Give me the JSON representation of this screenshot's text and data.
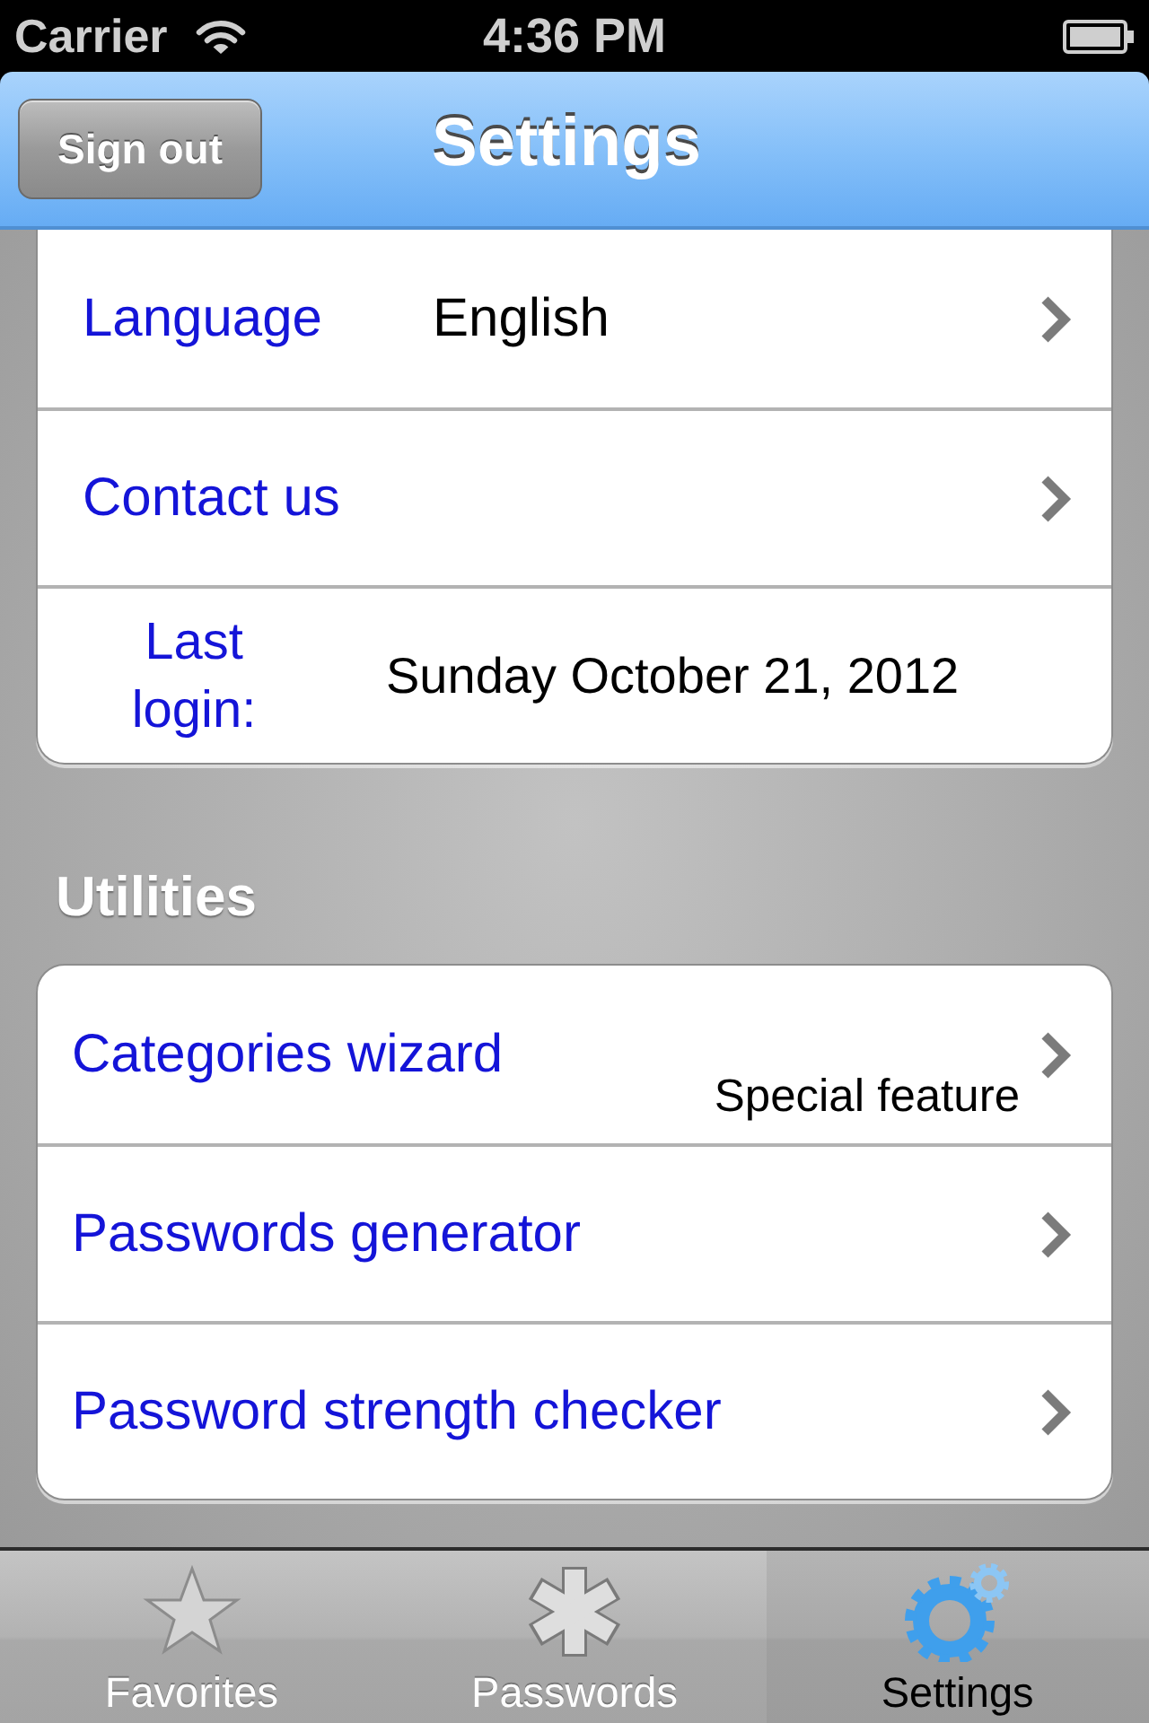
{
  "status_bar": {
    "carrier": "Carrier",
    "time": "4:36 PM"
  },
  "nav_bar": {
    "left_button": "Sign out",
    "title": "Settings"
  },
  "sections": [
    {
      "rows": [
        {
          "kind": "value",
          "label": "Language",
          "value": "English",
          "disclosure": true
        },
        {
          "kind": "value",
          "label": "Contact us",
          "disclosure": true
        },
        {
          "kind": "info",
          "label": "Last login:",
          "value": "Sunday October 21, 2012",
          "disclosure": false
        }
      ]
    },
    {
      "header": "Utilities",
      "rows": [
        {
          "kind": "subtitle",
          "label": "Categories wizard",
          "detail": "Special feature",
          "disclosure": true
        },
        {
          "kind": "link",
          "label": "Passwords generator",
          "disclosure": true
        },
        {
          "kind": "link",
          "label": "Password strength checker",
          "disclosure": true
        }
      ]
    }
  ],
  "tab_bar": [
    {
      "label": "Favorites",
      "selected": false
    },
    {
      "label": "Passwords",
      "selected": false
    },
    {
      "label": "Settings",
      "selected": true
    }
  ]
}
